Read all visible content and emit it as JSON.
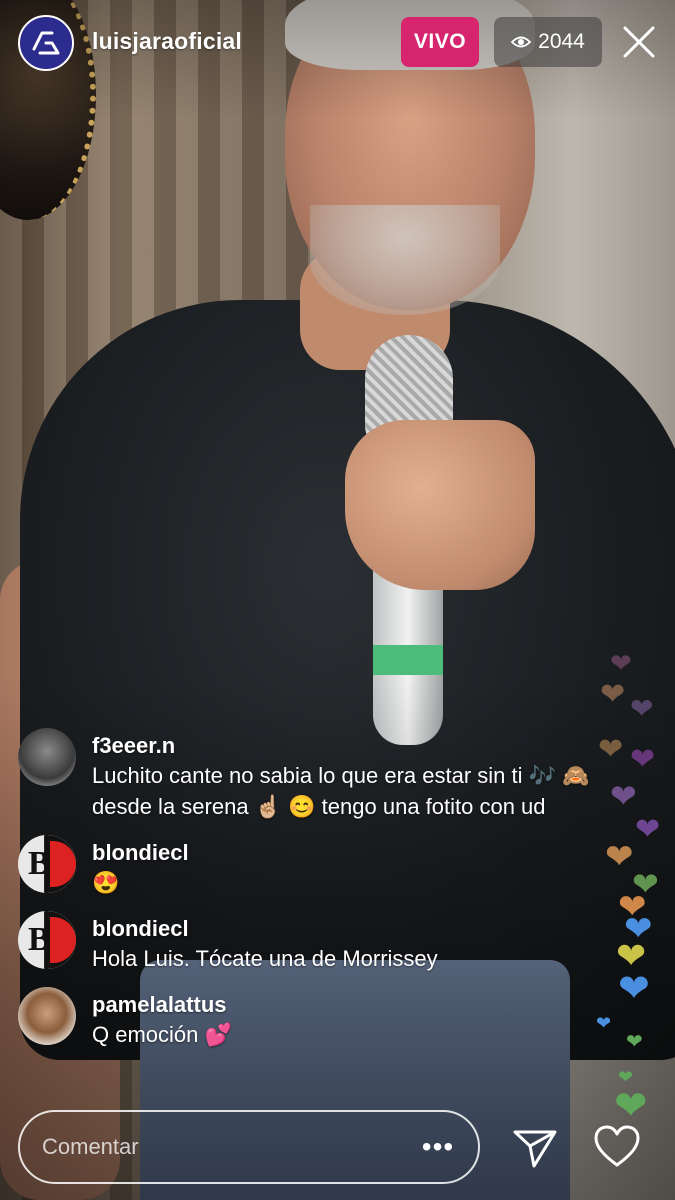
{
  "header": {
    "username": "luisjaraoficial",
    "live_label": "VIVO",
    "viewer_count": "2044"
  },
  "comments": [
    {
      "user": "f3eeer.n",
      "text": "Luchito cante no sabia lo que era estar sin ti 🎶 🙈 desde la serena ☝🏼 😊 tengo una fotito con ud"
    },
    {
      "user": "blondiecl",
      "text": "😍"
    },
    {
      "user": "blondiecl",
      "text": "Hola Luis. Tócate una de Morrissey"
    },
    {
      "user": "pamelalattus",
      "text": "Q emoción 💕"
    }
  ],
  "footer": {
    "input_placeholder": "Comentar",
    "more_label": "•••"
  },
  "icons": {
    "viewers": "eye-icon",
    "close": "close-icon",
    "share": "send-icon",
    "like": "heart-icon"
  },
  "colors": {
    "live_badge": "#d6246e",
    "accent_avatar": "#2c2b8e"
  }
}
